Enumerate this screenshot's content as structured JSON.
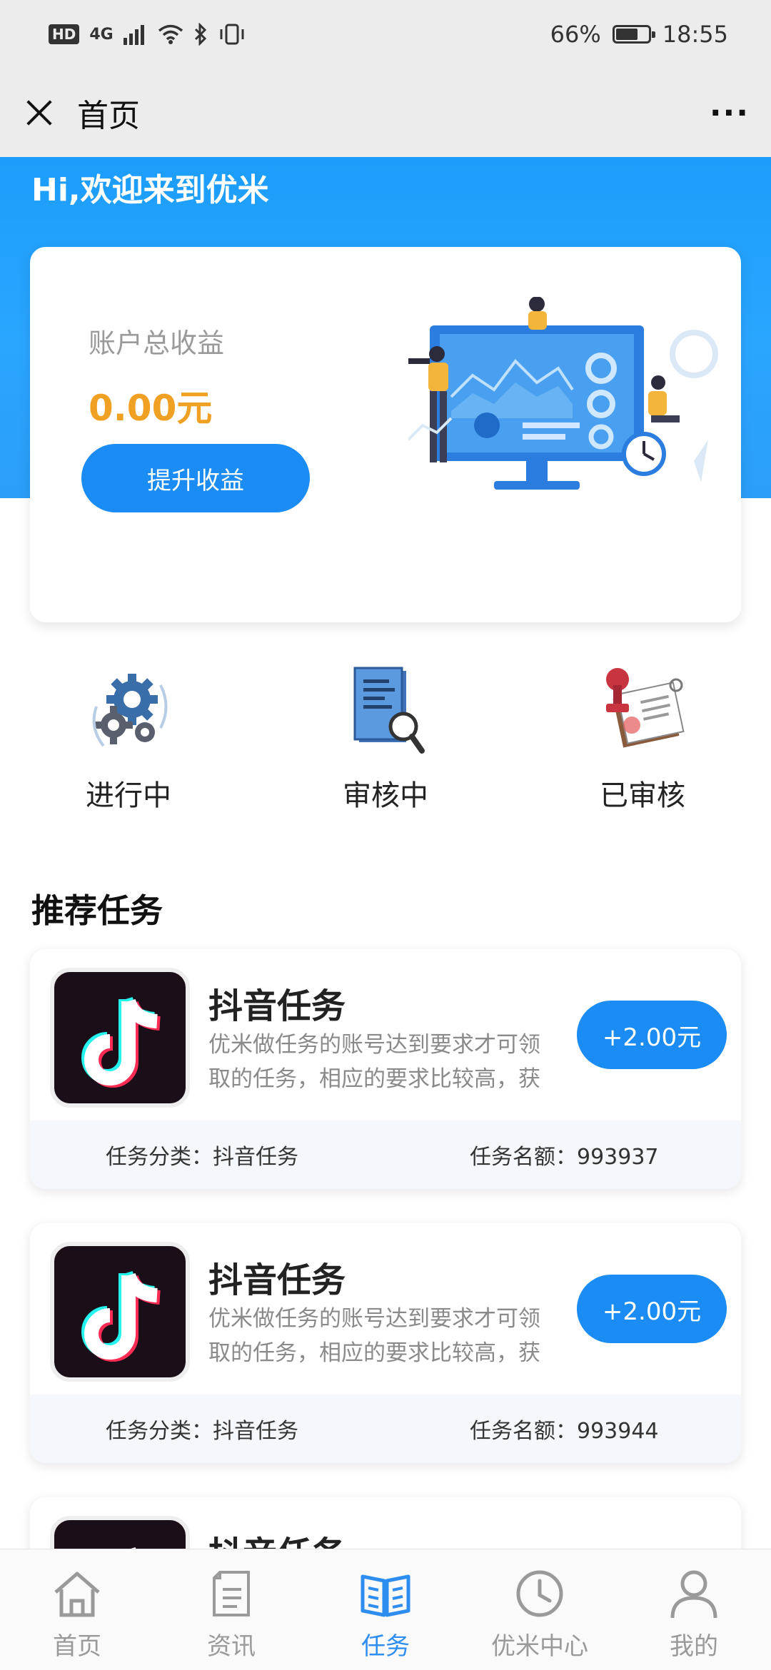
{
  "status_bar": {
    "network": "4G",
    "battery": "66%",
    "battery_level": 0.66,
    "time": "18:55"
  },
  "nav": {
    "title": "首页",
    "more": "···"
  },
  "hero": {
    "greeting": "Hi,欢迎来到优米"
  },
  "earnings": {
    "label": "账户总收益",
    "amount": "0.00元",
    "button": "提升收益"
  },
  "statuses": [
    {
      "label": "进行中",
      "icon": "gears-icon"
    },
    {
      "label": "审核中",
      "icon": "document-search-icon"
    },
    {
      "label": "已审核",
      "icon": "stamp-icon"
    }
  ],
  "section_title": "推荐任务",
  "tasks": [
    {
      "title": "抖音任务",
      "desc": "优米做任务的账号达到要求才可领取的任务，相应的要求比较高，获得佣",
      "reward": "+2.00元",
      "category_label": "任务分类：",
      "category": "抖音任务",
      "quota_label": "任务名额：",
      "quota": "993937"
    },
    {
      "title": "抖音任务",
      "desc": "优米做任务的账号达到要求才可领取的任务，相应的要求比较高，获得佣",
      "reward": "+2.00元",
      "category_label": "任务分类：",
      "category": "抖音任务",
      "quota_label": "任务名额：",
      "quota": "993944"
    },
    {
      "title": "抖音任务"
    }
  ],
  "tabs": [
    {
      "label": "首页",
      "icon": "home-icon"
    },
    {
      "label": "资讯",
      "icon": "news-icon"
    },
    {
      "label": "任务",
      "icon": "book-icon",
      "active": true
    },
    {
      "label": "优米中心",
      "icon": "clock-icon"
    },
    {
      "label": "我的",
      "icon": "user-icon"
    }
  ],
  "colors": {
    "accent": "#1b8cf3",
    "hero": "#2aa6ff",
    "amount": "#f0a124",
    "tab_active": "#2e8ef0",
    "tab_inactive": "#9a9a9a"
  }
}
